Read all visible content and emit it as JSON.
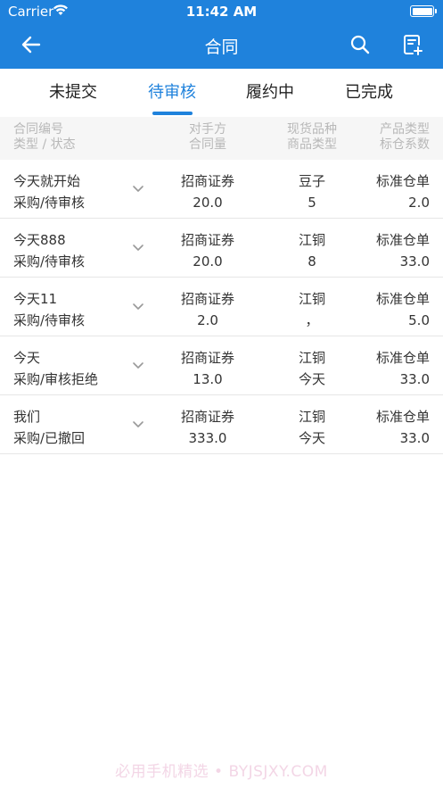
{
  "status_bar": {
    "carrier": "Carrier",
    "time": "11:42 AM"
  },
  "nav": {
    "title": "合同",
    "back_icon": "back-arrow-icon",
    "search_icon": "search-icon",
    "add_icon": "add-document-icon"
  },
  "tabs": [
    {
      "label": "未提交"
    },
    {
      "label": "待审核",
      "active": true
    },
    {
      "label": "履约中"
    },
    {
      "label": "已完成"
    }
  ],
  "columns": {
    "col1_line1": "合同编号",
    "col1_line2": "类型 / 状态",
    "col2_line1": "对手方",
    "col2_line2": "合同量",
    "col3_line1": "现货品种",
    "col3_line2": "商品类型",
    "col4_line1": "产品类型",
    "col4_line2": "标仓系数"
  },
  "rows": [
    {
      "name": "今天就开始",
      "type_status": "采购/待审核",
      "counterparty": "招商证券",
      "quantity": "20.0",
      "variety": "豆子",
      "goods_type": "5",
      "product_type": "标准仓单",
      "coefficient": "2.0"
    },
    {
      "name": "今天888",
      "type_status": "采购/待审核",
      "counterparty": "招商证券",
      "quantity": "20.0",
      "variety": "江铜",
      "goods_type": "8",
      "product_type": "标准仓单",
      "coefficient": "33.0"
    },
    {
      "name": "今天11",
      "type_status": "采购/待审核",
      "counterparty": "招商证券",
      "quantity": "2.0",
      "variety": "江铜",
      "goods_type": "，",
      "product_type": "标准仓单",
      "coefficient": "5.0"
    },
    {
      "name": "今天",
      "type_status": "采购/审核拒绝",
      "counterparty": "招商证券",
      "quantity": "13.0",
      "variety": "江铜",
      "goods_type": "今天",
      "product_type": "标准仓单",
      "coefficient": "33.0"
    },
    {
      "name": "我们",
      "type_status": "采购/已撤回",
      "counterparty": "招商证券",
      "quantity": "333.0",
      "variety": "江铜",
      "goods_type": "今天",
      "product_type": "标准仓单",
      "coefficient": "33.0"
    }
  ],
  "watermark": "必用手机精选 • BYJSJXY.COM",
  "colors": {
    "primary": "#1f82dc",
    "header_bg": "#f6f6f6",
    "muted_text": "#b8b8b8"
  }
}
